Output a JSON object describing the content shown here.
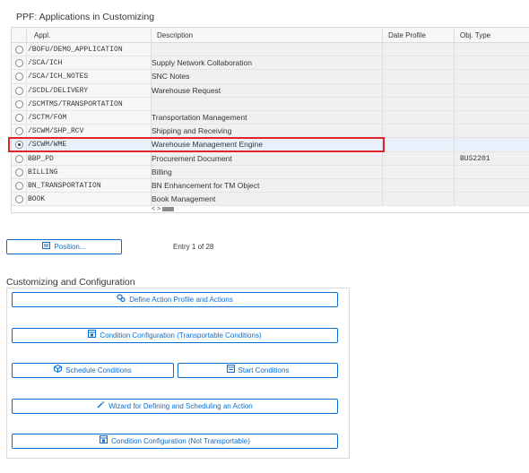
{
  "page": {
    "title": "PPF: Applications in Customizing",
    "section2_title": "Customizing and Configuration",
    "entry_text": "Entry 1 of 28"
  },
  "table": {
    "columns": [
      "Appl.",
      "Description",
      "Date Profile",
      "Obj. Type"
    ],
    "rows": [
      {
        "appl": "/BOFU/DEMO_APPLICATION",
        "desc": "",
        "date": "",
        "obj": "",
        "selected": false
      },
      {
        "appl": "/SCA/ICH",
        "desc": "Supply Network Collaboration",
        "date": "",
        "obj": "",
        "selected": false
      },
      {
        "appl": "/SCA/ICH_NOTES",
        "desc": "SNC Notes",
        "date": "",
        "obj": "",
        "selected": false
      },
      {
        "appl": "/SCDL/DELIVERY",
        "desc": "Warehouse Request",
        "date": "",
        "obj": "",
        "selected": false
      },
      {
        "appl": "/SCMTMS/TRANSPORTATION",
        "desc": "",
        "date": "",
        "obj": "",
        "selected": false
      },
      {
        "appl": "/SCTM/FOM",
        "desc": "Transportation Management",
        "date": "",
        "obj": "",
        "selected": false
      },
      {
        "appl": "/SCWM/SHP_RCV",
        "desc": "Shipping and Receiving",
        "date": "",
        "obj": "",
        "selected": false
      },
      {
        "appl": "/SCWM/WME",
        "desc": "Warehouse Management Engine",
        "date": "",
        "obj": "",
        "selected": true
      },
      {
        "appl": "BBP_PD",
        "desc": "Procurement Document",
        "date": "",
        "obj": "BUS2201",
        "selected": false
      },
      {
        "appl": "BILLING",
        "desc": "Billing",
        "date": "",
        "obj": "",
        "selected": false
      },
      {
        "appl": "BN_TRANSPORTATION",
        "desc": "BN Enhancement for TM Object",
        "date": "",
        "obj": "",
        "selected": false
      },
      {
        "appl": "BOOK",
        "desc": "Book Management",
        "date": "",
        "obj": "",
        "selected": false
      }
    ],
    "scroll_left": "<",
    "scroll_right": ">"
  },
  "buttons": {
    "position": {
      "label": "Position...",
      "icon": "position-icon"
    },
    "define_action_profile": {
      "label": "Define Action Profile and Actions",
      "icon": "gears-icon"
    },
    "condition_config_transportable": {
      "label": "Condition Configuration (Transportable Conditions)",
      "icon": "condition-config-icon"
    },
    "schedule_conditions": {
      "label": "Schedule Conditions",
      "icon": "cube-icon"
    },
    "start_conditions": {
      "label": "Start Conditions",
      "icon": "start-conditions-icon"
    },
    "wizard": {
      "label": "Wizard for Defining and Scheduling an Action",
      "icon": "wand-icon"
    },
    "condition_config_not_transportable": {
      "label": "Condition Configuration (Not Transportable)",
      "icon": "condition-config-icon"
    }
  },
  "colors": {
    "accent": "#0a6ed1",
    "highlight": "#e0242b",
    "selected_row": "#e8f1fb"
  }
}
